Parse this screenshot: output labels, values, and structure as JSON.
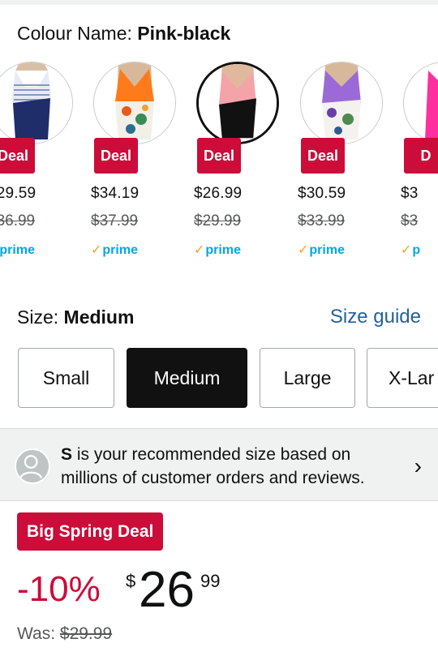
{
  "colour": {
    "label": "Colour Name: ",
    "value": "Pink-black"
  },
  "swatches": [
    {
      "deal": "Deal",
      "price": "$29.59",
      "was": "$36.99",
      "prime": "prime",
      "selected": false,
      "top_color": "#e6ebf5",
      "bottom_color": "#1f2d6b"
    },
    {
      "deal": "Deal",
      "price": "$34.19",
      "was": "$37.99",
      "prime": "prime",
      "selected": false,
      "top_color": "#ff7a1a",
      "bottom_color": "#3a8a5a"
    },
    {
      "deal": "Deal",
      "price": "$26.99",
      "was": "$29.99",
      "prime": "prime",
      "selected": true,
      "top_color": "#f4a3a8",
      "bottom_color": "#111111"
    },
    {
      "deal": "Deal",
      "price": "$30.59",
      "was": "$33.99",
      "prime": "prime",
      "selected": false,
      "top_color": "#9b6ad6",
      "bottom_color": "#4c8a4e"
    },
    {
      "deal": "D",
      "price": "$3",
      "was": "$3",
      "prime": "p",
      "selected": false,
      "top_color": "#ff2fa0",
      "bottom_color": "#ff2fa0"
    }
  ],
  "size": {
    "label": "Size: ",
    "value": "Medium",
    "guide": "Size guide",
    "options": [
      "Small",
      "Medium",
      "Large",
      "X-Lar"
    ]
  },
  "recommendation": {
    "bold": "S",
    "text": " is your recommended size based on millions of customer orders and reviews."
  },
  "deal_badge": "Big Spring Deal",
  "pricing": {
    "discount": "-10%",
    "currency": "$",
    "whole": "26",
    "fraction": "99",
    "was_label": "Was: ",
    "was_price": "$29.99"
  }
}
